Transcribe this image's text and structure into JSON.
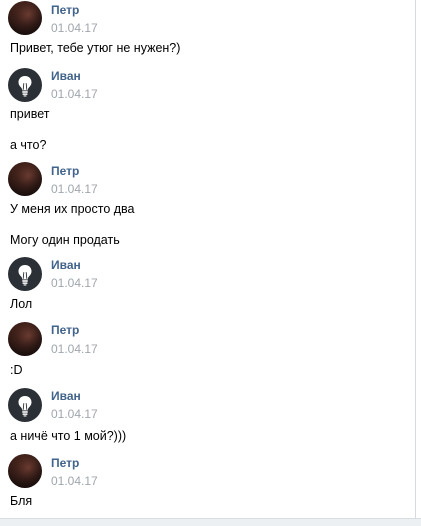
{
  "messages": [
    {
      "author": "Петр",
      "date": "01.04.17",
      "avatar": "photo-avatar",
      "lines": [
        "Привет, тебе утюг не нужен?)"
      ]
    },
    {
      "author": "Иван",
      "date": "01.04.17",
      "avatar": "lightbulb-icon",
      "lines": [
        "привет",
        "а что?"
      ]
    },
    {
      "author": "Петр",
      "date": "01.04.17",
      "avatar": "photo-avatar",
      "lines": [
        "У меня их просто два",
        "Могу один продать"
      ]
    },
    {
      "author": "Иван",
      "date": "01.04.17",
      "avatar": "lightbulb-icon",
      "lines": [
        "Лол"
      ]
    },
    {
      "author": "Петр",
      "date": "01.04.17",
      "avatar": "photo-avatar",
      "lines": [
        ":D"
      ]
    },
    {
      "author": "Иван",
      "date": "01.04.17",
      "avatar": "lightbulb-icon",
      "lines": [
        "а ничё что 1 мой?)))"
      ]
    },
    {
      "author": "Петр",
      "date": "01.04.17",
      "avatar": "photo-avatar",
      "lines": [
        "Бля"
      ]
    }
  ],
  "colors": {
    "author_name": "#42648b",
    "timestamp": "#a0a6ad",
    "message_text": "#000000",
    "bulb_avatar_bg": "#2b3036"
  }
}
